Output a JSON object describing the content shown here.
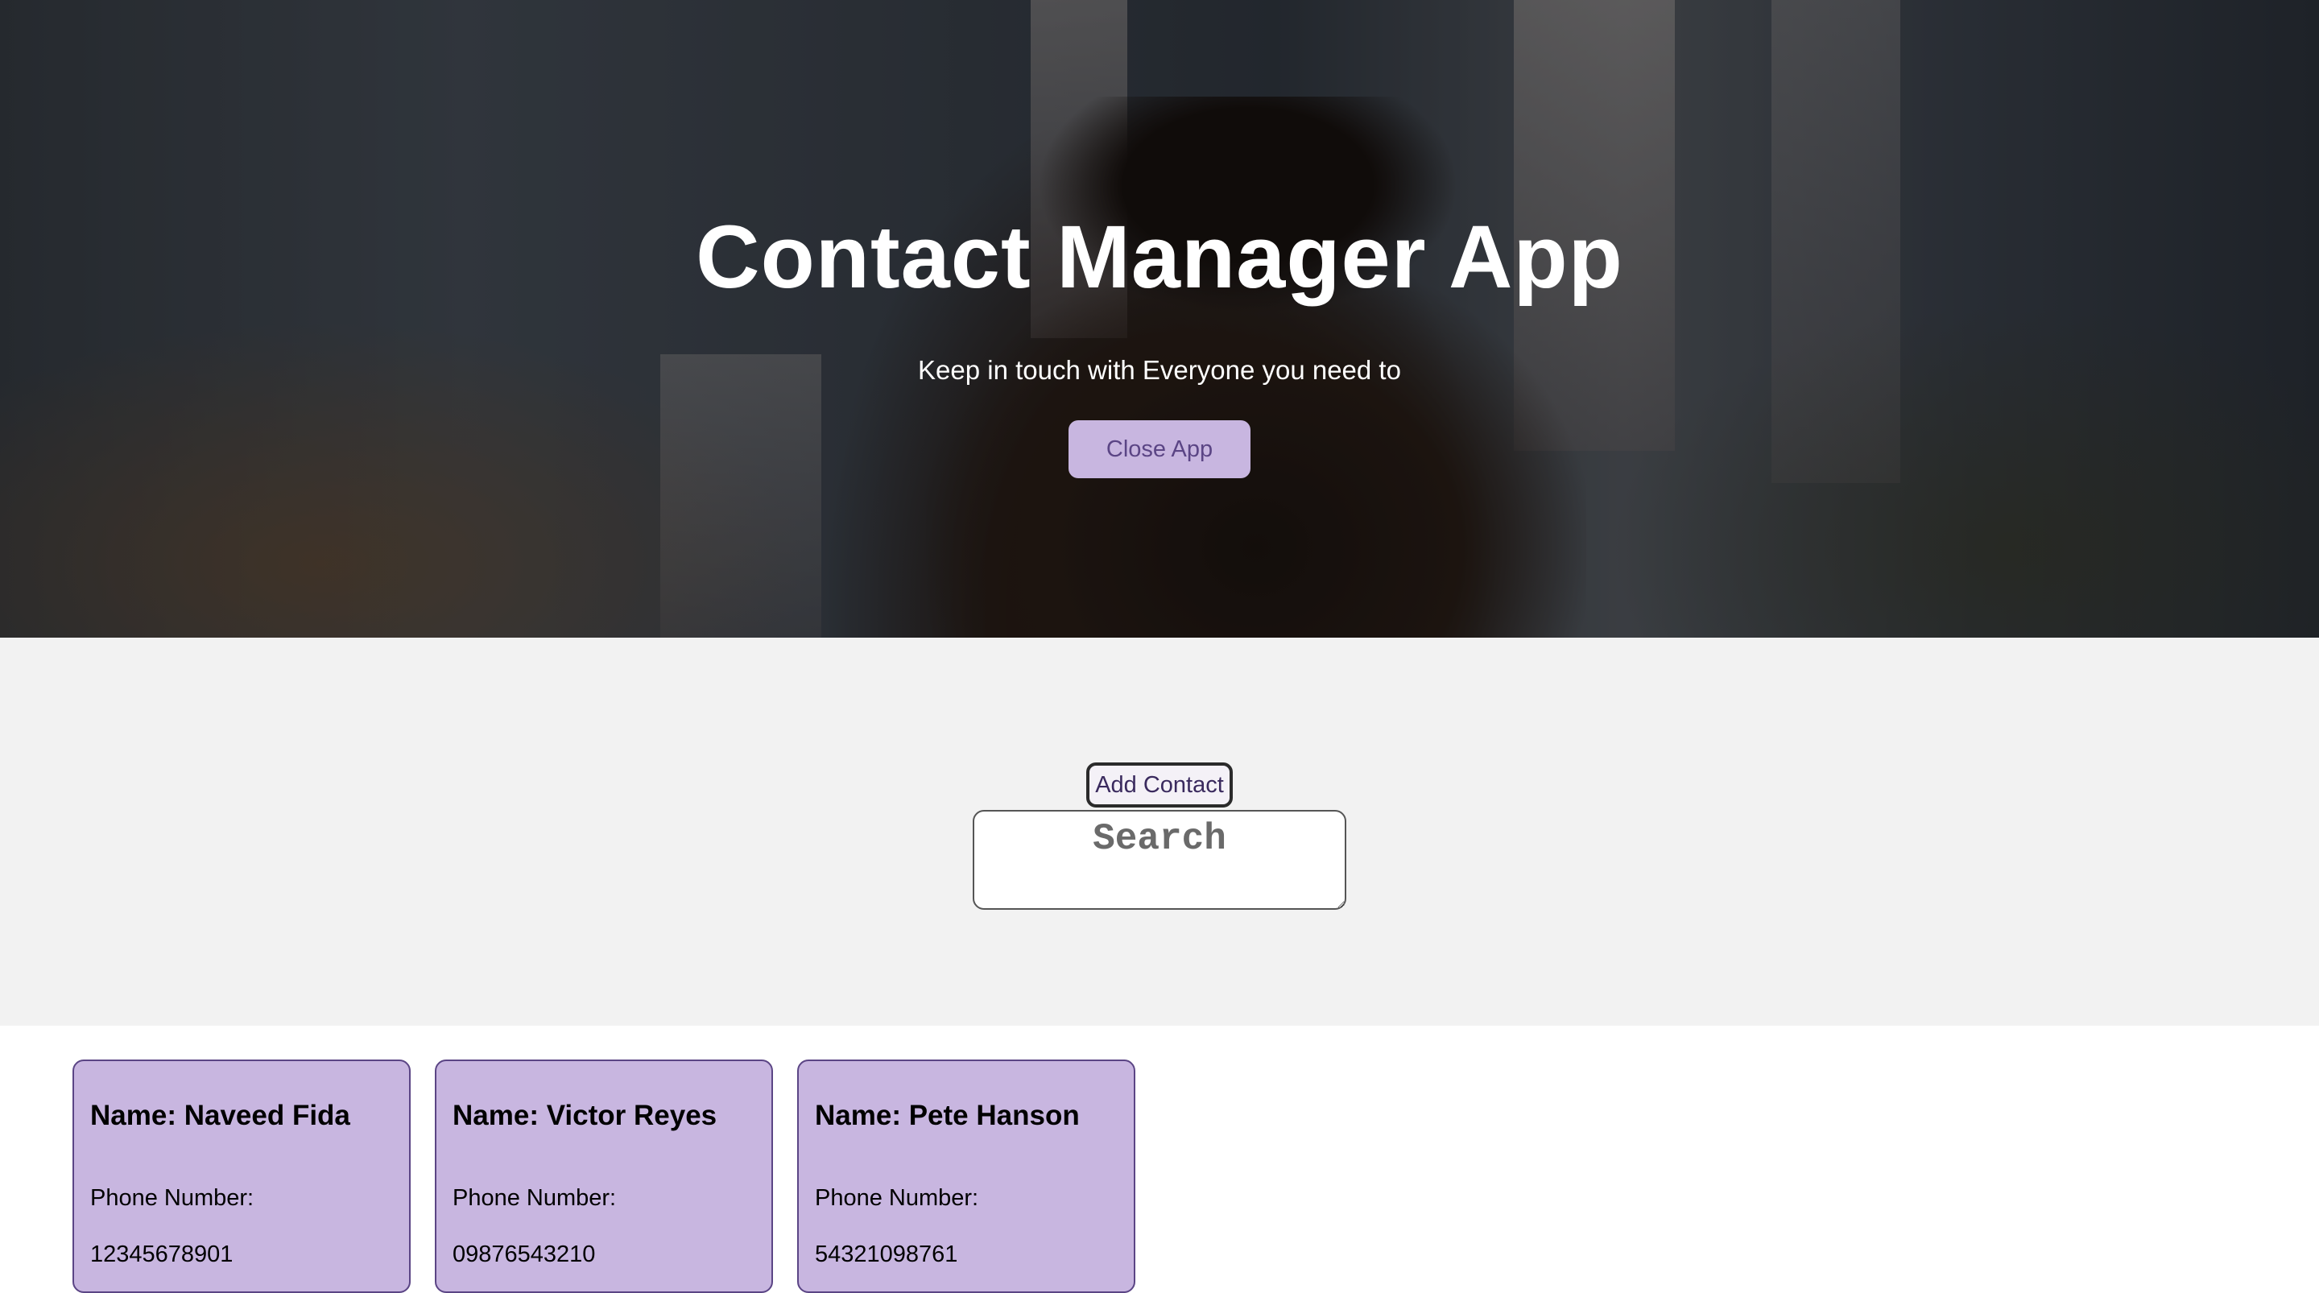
{
  "hero": {
    "title": "Contact Manager App",
    "subtitle": "Keep in touch with Everyone you need to",
    "close_button_label": "Close App"
  },
  "controls": {
    "add_button_label": "Add Contact",
    "search_placeholder": "Search"
  },
  "contacts": [
    {
      "name": "Name: Naveed Fida",
      "phone_label": "Phone Number:",
      "phone": "12345678901"
    },
    {
      "name": "Name: Victor Reyes",
      "phone_label": "Phone Number:",
      "phone": "09876543210"
    },
    {
      "name": "Name: Pete Hanson",
      "phone_label": "Phone Number:",
      "phone": "54321098761"
    }
  ],
  "colors": {
    "accent": "#c8b6e0",
    "accent_text": "#5b4585",
    "controls_bg": "#f2f2f2"
  }
}
